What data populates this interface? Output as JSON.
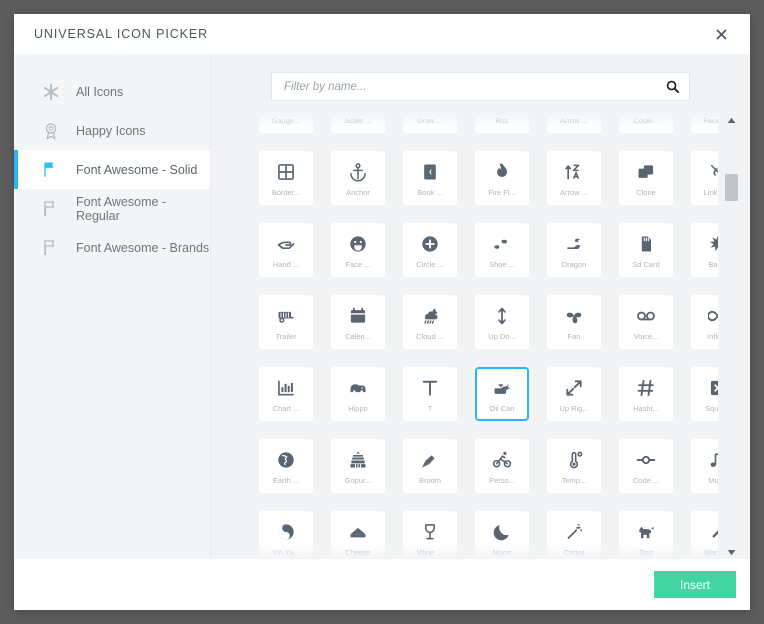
{
  "modal": {
    "title": "UNIVERSAL ICON PICKER",
    "close_label": "×",
    "accent_color": "#29b6f6",
    "insert_color": "#44d6a2",
    "backdrop_color": "#5d5d5d"
  },
  "sidebar": {
    "items": [
      {
        "label": "All Icons",
        "icon": "asterisk-icon",
        "active": false
      },
      {
        "label": "Happy Icons",
        "icon": "award-badge-icon",
        "active": false
      },
      {
        "label": "Font Awesome - Solid",
        "icon": "flag-solid-icon",
        "active": true
      },
      {
        "label": "Font Awesome - Regular",
        "icon": "flag-regular-icon",
        "active": false
      },
      {
        "label": "Font Awesome - Brands",
        "icon": "flag-brands-icon",
        "active": false
      }
    ]
  },
  "search": {
    "value": "",
    "placeholder": "Filter by name...",
    "icon": "search-icon"
  },
  "footer": {
    "insert_label": "Insert"
  },
  "scrollbar": {
    "up_icon": "caret-up-icon",
    "down_icon": "caret-down-icon",
    "thumb_position_pct": 12
  },
  "grid": {
    "columns": 7,
    "selected_label": "Oil Can",
    "icons": [
      {
        "label": "Gauge...",
        "icon": "gauge-icon",
        "clipped": "top"
      },
      {
        "label": "Scale ...",
        "icon": "scale-balanced-icon",
        "clipped": "top"
      },
      {
        "label": "Draw ...",
        "icon": "draw-polygon-icon",
        "clipped": "top"
      },
      {
        "label": "Rss",
        "icon": "rss-icon",
        "clipped": "top"
      },
      {
        "label": "Arrow ...",
        "icon": "arrow-icon",
        "clipped": "top"
      },
      {
        "label": "Cooki...",
        "icon": "cookie-icon",
        "clipped": "top"
      },
      {
        "label": "Face A...",
        "icon": "face-angry-icon",
        "clipped": "top"
      },
      {
        "label": "Border...",
        "icon": "border-all-icon"
      },
      {
        "label": "Anchor",
        "icon": "anchor-icon"
      },
      {
        "label": "Book ...",
        "icon": "book-quran-icon"
      },
      {
        "label": "Fire Fl...",
        "icon": "fire-flame-icon"
      },
      {
        "label": "Arrow ...",
        "icon": "arrow-up-z-a-icon"
      },
      {
        "label": "Clone",
        "icon": "clone-icon"
      },
      {
        "label": "Link Sl...",
        "icon": "link-slash-icon"
      },
      {
        "label": "Hand ...",
        "icon": "hand-holding-icon"
      },
      {
        "label": "Face ...",
        "icon": "face-grin-tongue-icon"
      },
      {
        "label": "Circle ...",
        "icon": "circle-plus-icon"
      },
      {
        "label": "Shoe ...",
        "icon": "shoe-prints-icon"
      },
      {
        "label": "Dragon",
        "icon": "dragon-icon"
      },
      {
        "label": "Sd Card",
        "icon": "sd-card-icon"
      },
      {
        "label": "Bahai",
        "icon": "bahai-icon"
      },
      {
        "label": "Trailer",
        "icon": "trailer-icon"
      },
      {
        "label": "Calen...",
        "icon": "calendar-icon"
      },
      {
        "label": "Cloud ...",
        "icon": "cloud-moon-rain-icon"
      },
      {
        "label": "Up Do...",
        "icon": "up-down-icon"
      },
      {
        "label": "Fan",
        "icon": "fan-icon"
      },
      {
        "label": "Voice...",
        "icon": "voicemail-icon"
      },
      {
        "label": "Infinity",
        "icon": "infinity-icon"
      },
      {
        "label": "Chart ...",
        "icon": "chart-bar-icon"
      },
      {
        "label": "Hippo",
        "icon": "hippo-icon"
      },
      {
        "label": "T",
        "icon": "letter-t-icon"
      },
      {
        "label": "Oil Can",
        "icon": "oil-can-icon",
        "selected": true
      },
      {
        "label": "Up Rig...",
        "icon": "up-right-down-left-icon"
      },
      {
        "label": "Hasht...",
        "icon": "hashtag-icon"
      },
      {
        "label": "Squar...",
        "icon": "square-xmark-icon"
      },
      {
        "label": "Earth ...",
        "icon": "earth-africa-icon"
      },
      {
        "label": "Gopur...",
        "icon": "gopuram-icon"
      },
      {
        "label": "Broom",
        "icon": "broom-icon"
      },
      {
        "label": "Perso...",
        "icon": "person-biking-icon"
      },
      {
        "label": "Temp...",
        "icon": "temperature-icon"
      },
      {
        "label": "Code ...",
        "icon": "code-commit-icon"
      },
      {
        "label": "Music",
        "icon": "music-icon"
      },
      {
        "label": "Yin Ya...",
        "icon": "yin-yang-icon",
        "clipped": "bottom"
      },
      {
        "label": "Cheese",
        "icon": "cheese-icon",
        "clipped": "bottom"
      },
      {
        "label": "Wine ...",
        "icon": "wine-glass-icon",
        "clipped": "bottom"
      },
      {
        "label": "Moon",
        "icon": "moon-icon",
        "clipped": "bottom"
      },
      {
        "label": "Carrot",
        "icon": "carrot-icon",
        "clipped": "bottom"
      },
      {
        "label": "Dog",
        "icon": "dog-icon",
        "clipped": "bottom"
      },
      {
        "label": "Wand ...",
        "icon": "wand-icon",
        "clipped": "bottom"
      }
    ]
  }
}
